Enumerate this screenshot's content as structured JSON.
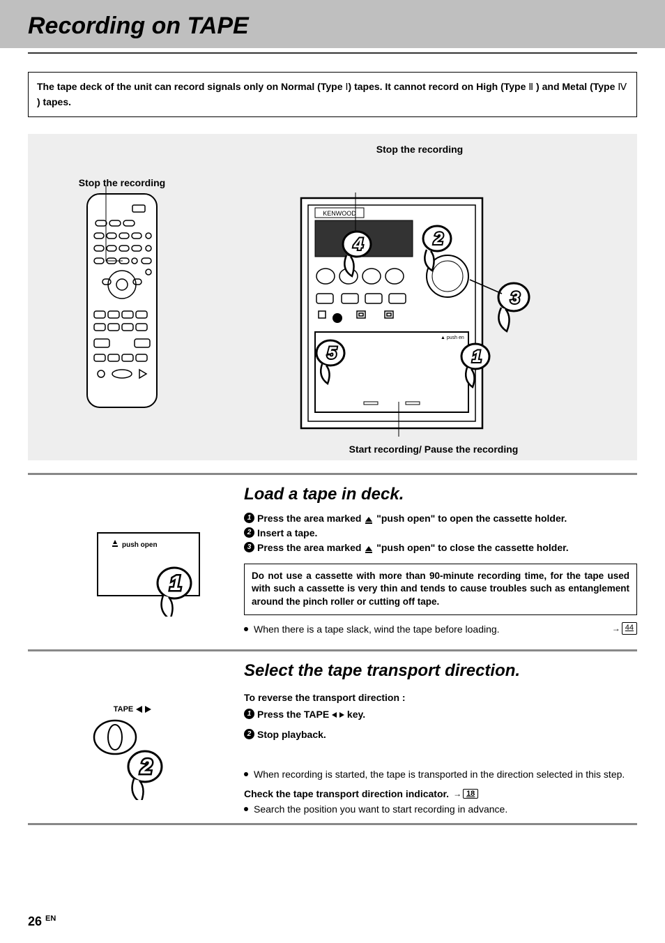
{
  "header": {
    "title": "Recording on TAPE"
  },
  "intro": {
    "before_type1": "The tape deck of the unit can record signals only on Normal (Type ",
    "type1": "Ⅰ",
    "mid": ") tapes. It cannot record on High (Type ",
    "type2": "Ⅱ",
    "mid2": " ) and Metal (Type ",
    "type4": "Ⅳ",
    "after": " ) tapes."
  },
  "diagram": {
    "stop_label_left": "Stop the recording",
    "stop_label_right": "Stop the recording",
    "start_label": "Start recording/ Pause the recording",
    "brand": "KENWOOD",
    "push_open_small": "push     en"
  },
  "step1": {
    "heading": "Load a tape in deck.",
    "push_open_label": "push open",
    "items": [
      {
        "before": "Press the area marked ",
        "after": " \"push open\" to open the cassette holder."
      },
      {
        "text": "Insert a tape."
      },
      {
        "before": "Press the area marked ",
        "after": " \"push open\" to close the cassette holder."
      }
    ],
    "note": "Do not use a cassette with more than 90-minute recording time, for the tape used with such a cassette is very thin and tends to cause troubles such as entanglement around the pinch roller or cutting off tape.",
    "bullet": "When there is a tape slack, wind the tape before loading.",
    "page_ref": "44"
  },
  "step2": {
    "heading": "Select the tape transport direction.",
    "sub": "To reverse the transport direction :",
    "tape_label": "TAPE",
    "items": [
      {
        "before": "Press the TAPE ",
        "after": " key."
      },
      {
        "text": "Stop playback."
      }
    ],
    "bullet1": "When recording is started, the tape is transported in the direction selected in this step.",
    "check_line": "Check the tape transport direction indicator.",
    "page_ref": "18",
    "bullet2": "Search the position you want to start recording in advance."
  },
  "footer": {
    "page": "26",
    "lang": "EN"
  }
}
